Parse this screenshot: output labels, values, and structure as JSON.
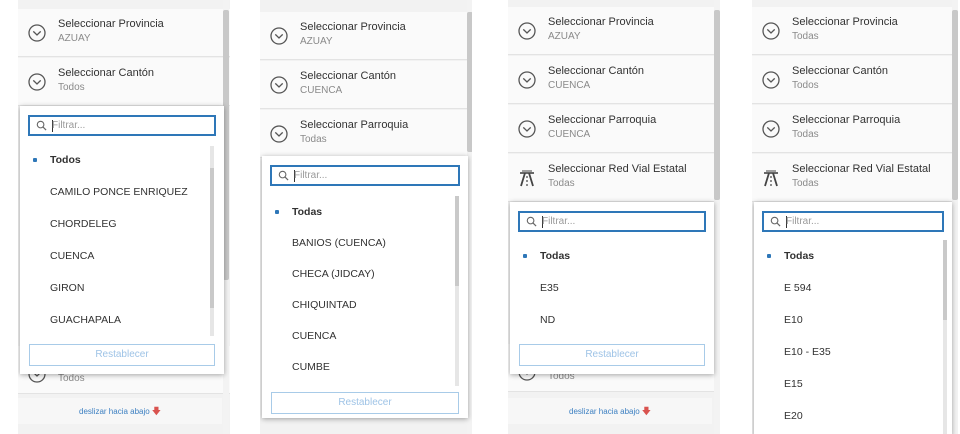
{
  "colors": {
    "accent": "#2e77b8",
    "selected_dot": "#2e77b8",
    "footer_link": "#3d80c2",
    "footer_arrow": "#d9534f"
  },
  "panels": [
    {
      "selectors": [
        {
          "title": "Seleccionar Provincia",
          "value": "AZUAY",
          "icon": "chevron-circle-icon"
        },
        {
          "title": "Seleccionar Cantón",
          "value": "Todos",
          "icon": "chevron-circle-icon"
        }
      ],
      "hidden_row_value": "Todos",
      "dropdown": {
        "search_placeholder": "Filtrar...",
        "options": [
          "Todos",
          "CAMILO PONCE ENRIQUEZ",
          "CHORDELEG",
          "CUENCA",
          "GIRON",
          "GUACHAPALA"
        ],
        "selected": "Todos",
        "reset_label": "Restablecer"
      },
      "footer": {
        "label": "deslizar hacia abajo",
        "icon": "arrow-down-icon"
      }
    },
    {
      "selectors": [
        {
          "title": "Seleccionar Provincia",
          "value": "AZUAY",
          "icon": "chevron-circle-icon"
        },
        {
          "title": "Seleccionar Cantón",
          "value": "CUENCA",
          "icon": "chevron-circle-icon"
        },
        {
          "title": "Seleccionar Parroquia",
          "value": "Todas",
          "icon": "chevron-circle-icon"
        }
      ],
      "dropdown": {
        "search_placeholder": "Filtrar...",
        "options": [
          "Todas",
          "BANIOS (CUENCA)",
          "CHECA (JIDCAY)",
          "CHIQUINTAD",
          "CUENCA",
          "CUMBE"
        ],
        "selected": "Todas",
        "reset_label": "Restablecer"
      }
    },
    {
      "selectors": [
        {
          "title": "Seleccionar Provincia",
          "value": "AZUAY",
          "icon": "chevron-circle-icon"
        },
        {
          "title": "Seleccionar Cantón",
          "value": "CUENCA",
          "icon": "chevron-circle-icon"
        },
        {
          "title": "Seleccionar Parroquia",
          "value": "CUENCA",
          "icon": "chevron-circle-icon"
        },
        {
          "title": "Seleccionar Red Vial Estatal",
          "value": "Todas",
          "icon": "highway-icon"
        }
      ],
      "hidden_row_value": "Todos",
      "dropdown": {
        "search_placeholder": "Filtrar...",
        "options": [
          "Todas",
          "E35",
          "ND"
        ],
        "selected": "Todas",
        "reset_label": "Restablecer"
      },
      "footer": {
        "label": "deslizar hacia abajo",
        "icon": "arrow-down-icon"
      }
    },
    {
      "selectors": [
        {
          "title": "Seleccionar Provincia",
          "value": "Todas",
          "icon": "chevron-circle-icon"
        },
        {
          "title": "Seleccionar Cantón",
          "value": "Todos",
          "icon": "chevron-circle-icon"
        },
        {
          "title": "Seleccionar Parroquia",
          "value": "Todas",
          "icon": "chevron-circle-icon"
        },
        {
          "title": "Seleccionar Red Vial Estatal",
          "value": "Todas",
          "icon": "highway-icon"
        }
      ],
      "dropdown": {
        "search_placeholder": "Filtrar...",
        "options": [
          "Todas",
          "E 594",
          "E10",
          "E10 - E35",
          "E15",
          "E20"
        ],
        "selected": "Todas"
      }
    }
  ]
}
